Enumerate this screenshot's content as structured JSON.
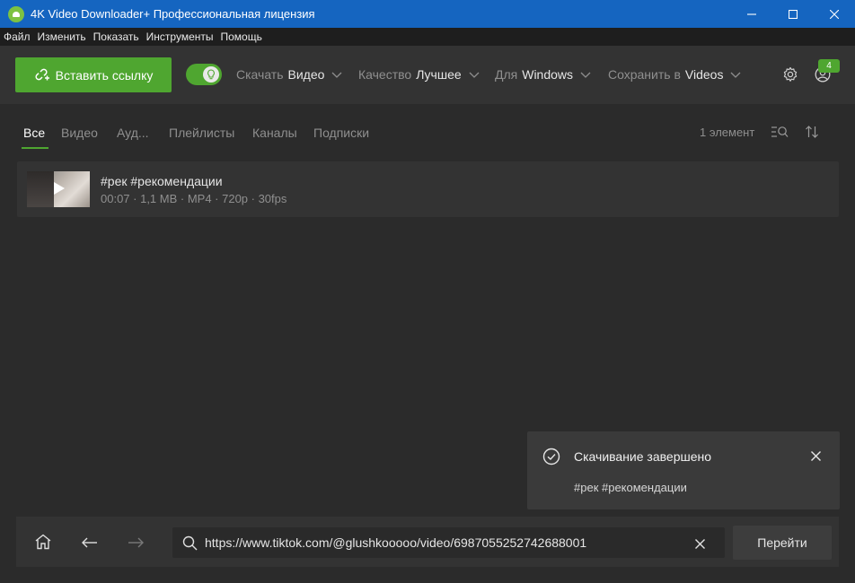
{
  "window": {
    "title": "4K Video Downloader+ Профессиональная лицензия"
  },
  "menu": [
    "Файл",
    "Изменить",
    "Показать",
    "Инструменты",
    "Помощь"
  ],
  "toolbar": {
    "paste_label": "Вставить ссылку",
    "download": {
      "label": "Скачать",
      "value": "Видео"
    },
    "quality": {
      "label": "Качество",
      "value": "Лучшее"
    },
    "platform": {
      "label": "Для",
      "value": "Windows"
    },
    "save_to": {
      "label": "Сохранить в",
      "value": "Videos"
    },
    "badge_count": "4",
    "smart_mode_on": true
  },
  "tabs": [
    "Все",
    "Видео",
    "Ауд...",
    "Плейлисты",
    "Каналы",
    "Подписки"
  ],
  "active_tab": "Все",
  "item_count": "1 элемент",
  "items": [
    {
      "title": "#рек #рекомендации",
      "meta": "00:07 · 1,1 MB · MP4 · 720p · 30fps"
    }
  ],
  "toast": {
    "title": "Скачивание завершено",
    "subtitle": "#рек #рекомендации"
  },
  "bottom": {
    "url": "https://www.tiktok.com/@glushkooooo/video/6987055252742688001",
    "go_label": "Перейти"
  },
  "colors": {
    "accent": "#4fa630",
    "titlebar": "#1565c0",
    "background": "#2b2b2b"
  }
}
